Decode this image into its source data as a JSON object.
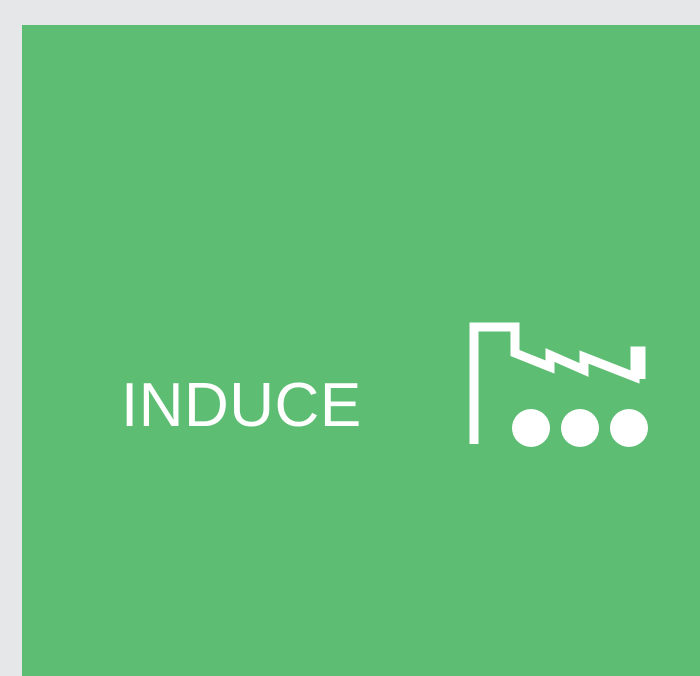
{
  "logo": {
    "wordmark": "INDUCE",
    "icon": "factory-icon",
    "colors": {
      "background": "#5dbe73",
      "foreground": "#ffffff",
      "frame": "#e6e7e9"
    }
  }
}
